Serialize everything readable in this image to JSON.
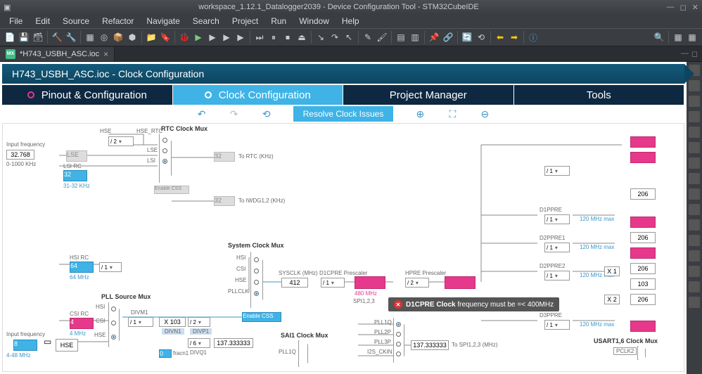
{
  "window": {
    "title": "workspace_1.12.1_Datalogger2039 - Device Configuration Tool - STM32CubeIDE"
  },
  "menu": [
    "File",
    "Edit",
    "Source",
    "Refactor",
    "Navigate",
    "Search",
    "Project",
    "Run",
    "Window",
    "Help"
  ],
  "tab": {
    "label": "*H743_USBH_ASC.ioc",
    "close": "×"
  },
  "breadcrumb": "H743_USBH_ASC.ioc - Clock Configuration",
  "navtabs": {
    "pinout": "Pinout & Configuration",
    "clock": "Clock Configuration",
    "project": "Project Manager",
    "tools": "Tools"
  },
  "ctrl": {
    "resolve": "Resolve Clock Issues"
  },
  "diagram": {
    "input_freq_lbl": "Input frequency",
    "lse_freq": "32.768",
    "lse_range": "0-1000 KHz",
    "lse_name": "LSE",
    "lsi_rc": "LSI RC",
    "lsi_val": "32",
    "lsi_range": "31-32 KHz",
    "hsi_rc": "HSI RC",
    "hsi_val": "64",
    "hsi_mhz": "64 MHz",
    "csi_rc": "CSI RC",
    "csi_val": "4",
    "csi_mhz": "4 MHz",
    "hse_name": "HSE",
    "hse_val": "8",
    "hse_mhz": "4-48 MHz",
    "hse_div2": "/ 2",
    "hse_rtc": "HSE_RTC",
    "rtc_mux": "RTC Clock Mux",
    "to_rtc": "To RTC (KHz)",
    "to_iwdg": "To IWDG1,2 (KHz)",
    "enable_css_rtc": "Enable CSS",
    "div1": "/ 1",
    "pll_src_mux": "PLL Source Mux",
    "hsi_lbl": "HSI",
    "csi_lbl": "CSI",
    "hse_lbl": "HSE",
    "lse_lbl": "LSE",
    "lsi_lbl": "LSI",
    "pllclk_lbl": "PLLCLK",
    "divm1_lbl": "DIVM1",
    "divm1": "/ 1",
    "x103": "X 103",
    "divn1_lbl": "DIVN1",
    "divn1_div2": "/ 2",
    "divp1_lbl": "DIVP1",
    "divp1": "/ 6",
    "divq1_lbl": "DIVQ1",
    "fracn1_lbl": "fracn1",
    "fracn1_val": "0",
    "divp_out": "137.333333",
    "sys_mux": "System Clock Mux",
    "enable_css_sys": "Enable CSS",
    "sysclk_lbl": "SYSCLK (MHz)",
    "sysclk_val": "412",
    "d1cpre_lbl": "D1CPRE Prescaler",
    "d1cpre_div": "/ 1",
    "d1cpre_clk": "480 MHz",
    "spi123_lbl": "SPI1,2,3",
    "hpre_lbl": "HPRE Prescaler",
    "hpre_div": "/ 2",
    "pll1q": "PLL1Q",
    "pll2p": "PLL2P",
    "pll3p": "PLL3P",
    "i2s_ckin": "I2S_CKIN",
    "sai1_mux": "SAI1 Clock Mux",
    "to_spi": "To SPI1,2,3 (MHz)",
    "spi_val": "137.333333",
    "d1ppre_lbl": "D1PPRE",
    "d1ppre_div": "/ 1",
    "d2ppre1_lbl": "D2PPRE1",
    "d2ppre1_div": "/ 1",
    "d2ppre2_lbl": "D2PPRE2",
    "d2ppre2_div": "/ 1",
    "d3ppre_lbl": "D3PPRE",
    "d3ppre_div": "/ 1",
    "max120": "120 MHz max",
    "x1": "X 1",
    "x2": "X 2",
    "val206": "206",
    "val103": "103",
    "usart_mux": "USART1,6 Clock Mux",
    "pclk2": "PCLK2",
    "rtc32": "32",
    "iwdg32": "32"
  },
  "error": {
    "bold": "D1CPRE Clock",
    "rest": " frequency must be =< 400MHz"
  }
}
